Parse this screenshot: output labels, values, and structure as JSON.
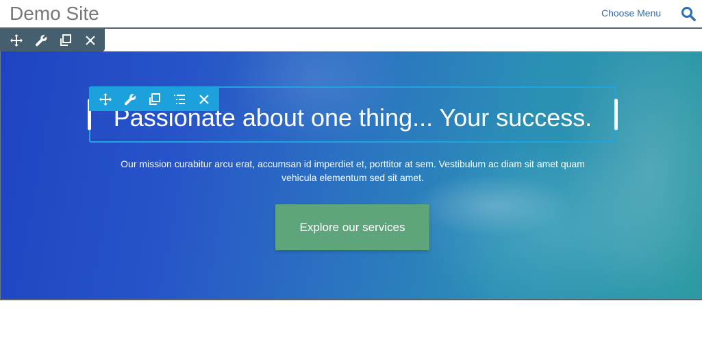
{
  "header": {
    "site_title": "Demo Site",
    "menu_label": "Choose Menu",
    "search_icon": "search-icon"
  },
  "row_toolbar": {
    "icons": [
      "move-icon",
      "wrench-icon",
      "duplicate-icon",
      "close-icon"
    ]
  },
  "module_toolbar": {
    "icons": [
      "move-icon",
      "wrench-icon",
      "duplicate-icon",
      "list-icon",
      "close-icon"
    ]
  },
  "hero": {
    "heading": "Passionate about one thing... Your success.",
    "body": "Our mission curabitur arcu erat, accumsan id imperdiet et, porttitor at sem. Vestibulum ac diam sit amet quam vehicula elementum sed sit amet.",
    "cta_label": "Explore our services"
  },
  "colors": {
    "title_gray": "#777777",
    "link_blue": "#2a6db5",
    "row_toolbar_bg": "#465f6e",
    "module_toolbar_bg": "#1da1dc",
    "cta_green": "#5ea57c",
    "hero_gradient_start": "#1f44c2",
    "hero_gradient_end": "#2c9aa3"
  }
}
